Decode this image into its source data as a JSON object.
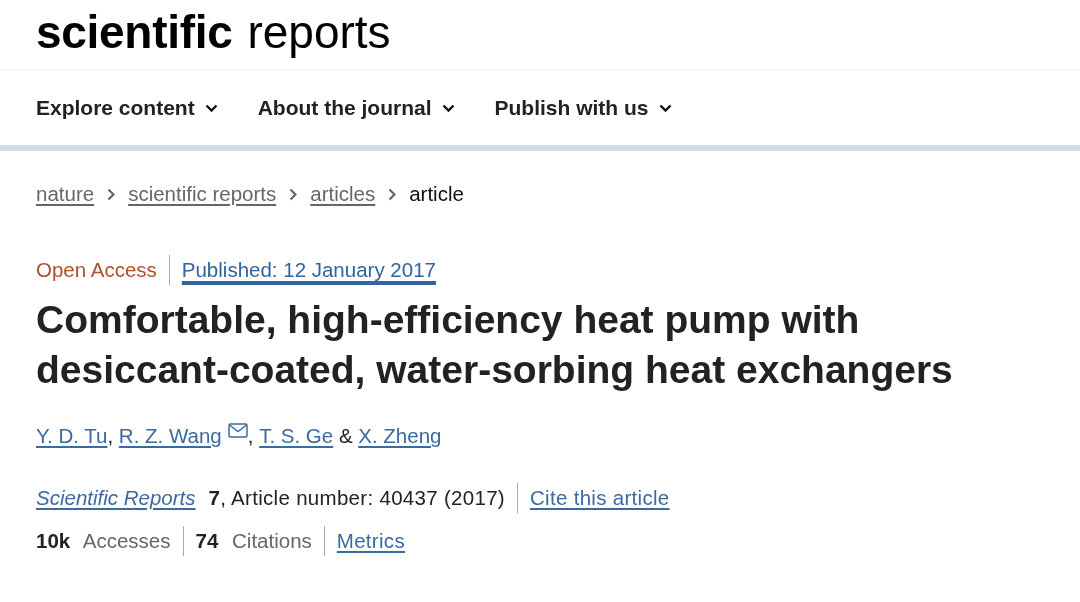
{
  "logo": {
    "bold": "scientific",
    "light": "reports"
  },
  "nav": [
    {
      "label": "Explore content"
    },
    {
      "label": "About the journal"
    },
    {
      "label": "Publish with us"
    }
  ],
  "breadcrumb": [
    {
      "label": "nature",
      "kind": "link"
    },
    {
      "label": "scientific reports",
      "kind": "link"
    },
    {
      "label": "articles",
      "kind": "link"
    },
    {
      "label": "article",
      "kind": "current"
    }
  ],
  "article": {
    "access": "Open Access",
    "published": "Published: 12 January 2017",
    "title": "Comfortable, high-efficiency heat pump with desiccant-coated, water-sorbing heat exchangers",
    "authors": [
      {
        "name": "Y. D. Tu",
        "corresponding": false,
        "joiner": ","
      },
      {
        "name": "R. Z. Wang",
        "corresponding": true,
        "joiner": ","
      },
      {
        "name": "T. S. Ge",
        "corresponding": false,
        "joiner": "&"
      },
      {
        "name": "X. Zheng",
        "corresponding": false
      }
    ],
    "journal": "Scientific Reports",
    "citation": "**7**, Article number: 40437 (2017)",
    "cite_link": "Cite this article",
    "metrics": [
      "**10k** Accesses",
      "**74** Citations"
    ],
    "metrics_link": "Metrics"
  }
}
